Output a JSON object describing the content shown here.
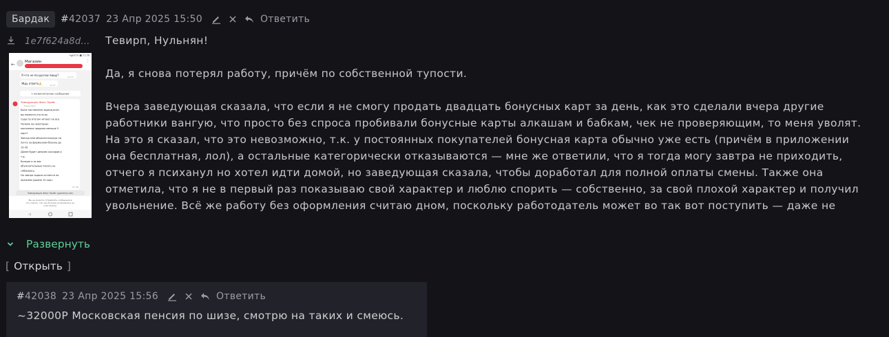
{
  "post": {
    "board": "Бардак",
    "hash": "#",
    "number": "42037",
    "date": "23 Апр 2025 15:50",
    "reply_label": "Ответить",
    "file_name": "1e7f624a8d…",
    "paragraphs": [
      "Тевирп, Нульнян!",
      "Да, я снова потерял работу, причём по собственной тупости.",
      "Вчера заведующая сказала, что если я не смогу продать двадцать бонусных карт за день, как это сделали вчера другие работники вангую, что просто без спроса пробивали бонусные карты алкашам и бабкам, чек не проверяющим, то меня уволят. На это я сказал, что это невозможно, т.к. у постоянных покупателей бонусная карта обычно уже есть (причём в приложении она бесплатная, лол), а остальные категорически отказываются — мне же ответили, что я тогда могу завтра не приходить, отчего я психанул но хотел идти домой, но заведующая сказала, чтобы доработал для полной оплаты смены. Также она отметила, что я не в первый раз показываю свой характер и люблю спорить — собственно, за свой плохой характер и получил увольнение. Всё же работу без оформления считаю дном, поскольку работодатель может во так вот поступить — даже не знаю, стоит ли жаловаться в трудовую инспекцию, чтобы мне хотя бы эти три месяца в Fix Price"
    ],
    "expand_label": "Развернуть",
    "open_label": "Открыть",
    "open_bracket_left": "[",
    "open_bracket_right": "]"
  },
  "thumbnail": {
    "status_bar": "▾◢ 61% ■ 21:58",
    "chat_title": "Магазин",
    "msg1": "Я что не по-русски пишу?",
    "msg1_time": "12:37",
    "msg2": "Жду ответа🙏",
    "msg2_time": "12:37",
    "unread_label": "1 непрочитанное сообщение",
    "sender": "Заведующая Фикс Прайс",
    "forwarded": "Переслано",
    "lines": [
      "Была поставлена задача,если",
      "вы помните,что если",
      "Суда по итогам читают не все",
      "Почему на некоторых",
      "магазинах продано меньше 5",
      "карт?",
      "Завтра мне объяснительную на",
      "почту на фирменном бланке до",
      "10-30.",
      "Далее будет депрем кассиров и",
      "т.д.",
      "Больше я за вас",
      "объяснительные писать не",
      "собираюсь.",
      "На завтра задача остаётся на",
      "прежнем уровне 10 карт."
    ],
    "msg3_time": "21:48",
    "deleted_note": "Заведующая Фикс Прайс удалил(а) вас",
    "footer": "Вы не можете отправлять сообщения в эту группу, так как больше не являетесь ее участником."
  },
  "reply": {
    "hash": "#",
    "number": "42038",
    "date": "23 Апр 2025 15:56",
    "reply_label": "Ответить",
    "text": "~32000Р Московская пенсия по шизе, смотрю на таких и смеюсь."
  },
  "colors": {
    "background": "#131318",
    "accent": "#5fcf9a",
    "card": "#22222a",
    "redacted": "#e63946"
  },
  "icons": [
    "pencil-icon",
    "close-icon",
    "reply-icon",
    "download-icon",
    "chevron-down-icon"
  ]
}
